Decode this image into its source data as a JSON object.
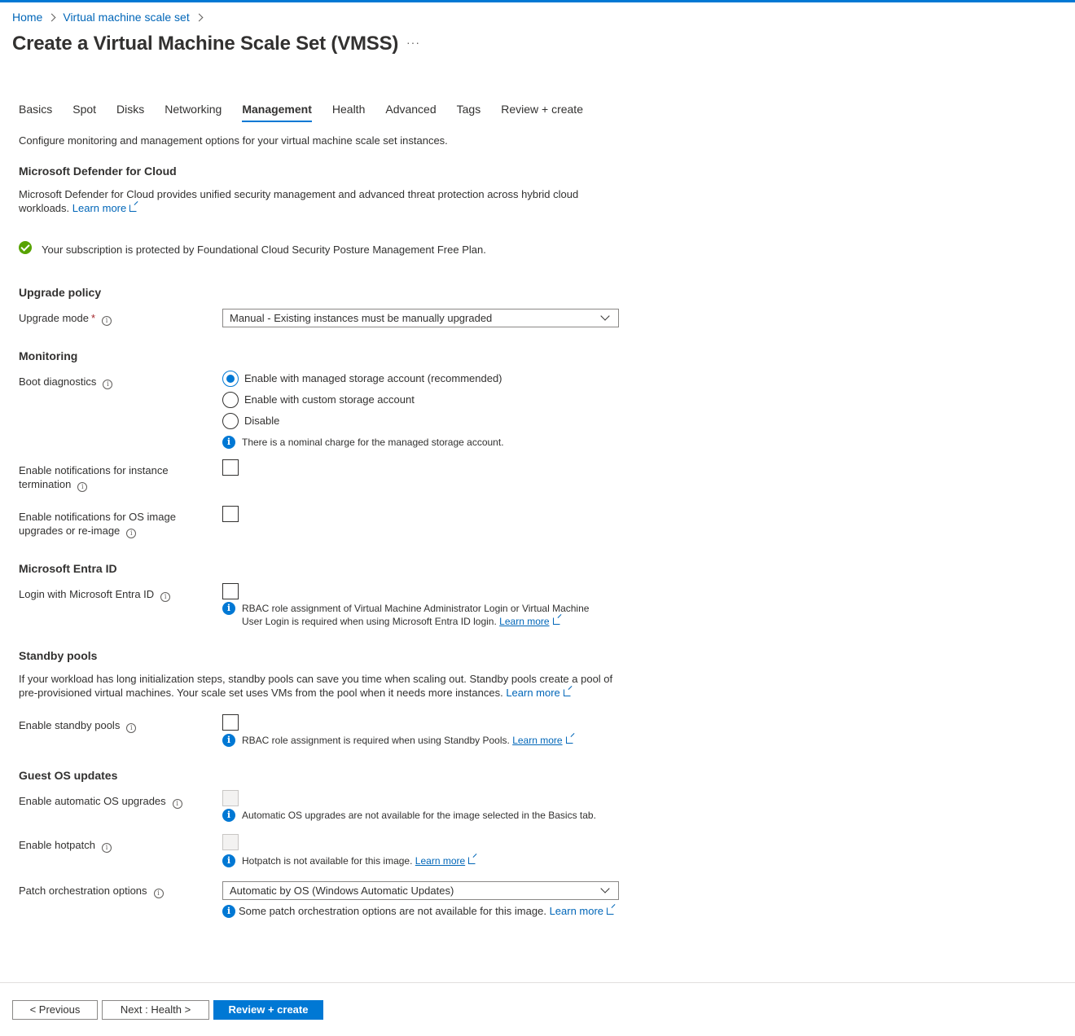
{
  "breadcrumb": [
    "Home",
    "Virtual machine scale set"
  ],
  "page_title": "Create a Virtual Machine Scale Set (VMSS)",
  "more_label": "···",
  "tabs": [
    "Basics",
    "Spot",
    "Disks",
    "Networking",
    "Management",
    "Health",
    "Advanced",
    "Tags",
    "Review + create"
  ],
  "active_tab": "Management",
  "intro": "Configure monitoring and management options for your virtual machine scale set instances.",
  "defender": {
    "heading": "Microsoft Defender for Cloud",
    "desc1": "Microsoft Defender for Cloud provides unified security management and advanced threat protection across hybrid cloud",
    "desc2": "workloads.",
    "learn_more": "Learn more",
    "status": "Your subscription is protected by Foundational Cloud Security Posture Management Free Plan."
  },
  "upgrade": {
    "heading": "Upgrade policy",
    "mode_label": "Upgrade mode",
    "required_mark": "*",
    "mode_value": "Manual - Existing instances must be manually upgraded"
  },
  "monitoring": {
    "heading": "Monitoring",
    "boot_label": "Boot diagnostics",
    "options": [
      "Enable with managed storage account (recommended)",
      "Enable with custom storage account",
      "Disable"
    ],
    "selected": "Enable with managed storage account (recommended)",
    "charge_note": "There is a nominal charge for the managed storage account.",
    "notif_termination_1": "Enable notifications for instance",
    "notif_termination_2": "termination",
    "notif_os_1": "Enable notifications for OS image",
    "notif_os_2": "upgrades or re-image"
  },
  "entra": {
    "heading": "Microsoft Entra ID",
    "login_label": "Login with Microsoft Entra ID",
    "note1": "RBAC role assignment of Virtual Machine Administrator Login or Virtual Machine",
    "note2": "User Login is required when using Microsoft Entra ID login.",
    "learn_more": "Learn more"
  },
  "standby": {
    "heading": "Standby pools",
    "desc1": "If your workload has long initialization steps, standby pools can save you time when scaling out. Standby pools create a pool of",
    "desc2": "pre-provisioned virtual machines. Your scale set uses VMs from the pool when it needs more instances.",
    "learn_more": "Learn more",
    "enable_label": "Enable standby pools",
    "note": "RBAC role assignment is required when using Standby Pools.",
    "note_learn_more": "Learn more"
  },
  "guest_os": {
    "heading": "Guest OS updates",
    "auto_upgrade_label": "Enable automatic OS upgrades",
    "auto_upgrade_note": "Automatic OS upgrades are not available for the image selected in the Basics tab.",
    "hotpatch_label": "Enable hotpatch",
    "hotpatch_note": "Hotpatch is not available for this image.",
    "hotpatch_learn_more": "Learn more",
    "patch_label": "Patch orchestration options",
    "patch_value": "Automatic by OS (Windows Automatic Updates)",
    "patch_note": "Some patch orchestration options are not available for this image.",
    "patch_learn_more": "Learn more"
  },
  "footer": {
    "previous": "< Previous",
    "next": "Next : Health >",
    "review": "Review + create"
  }
}
